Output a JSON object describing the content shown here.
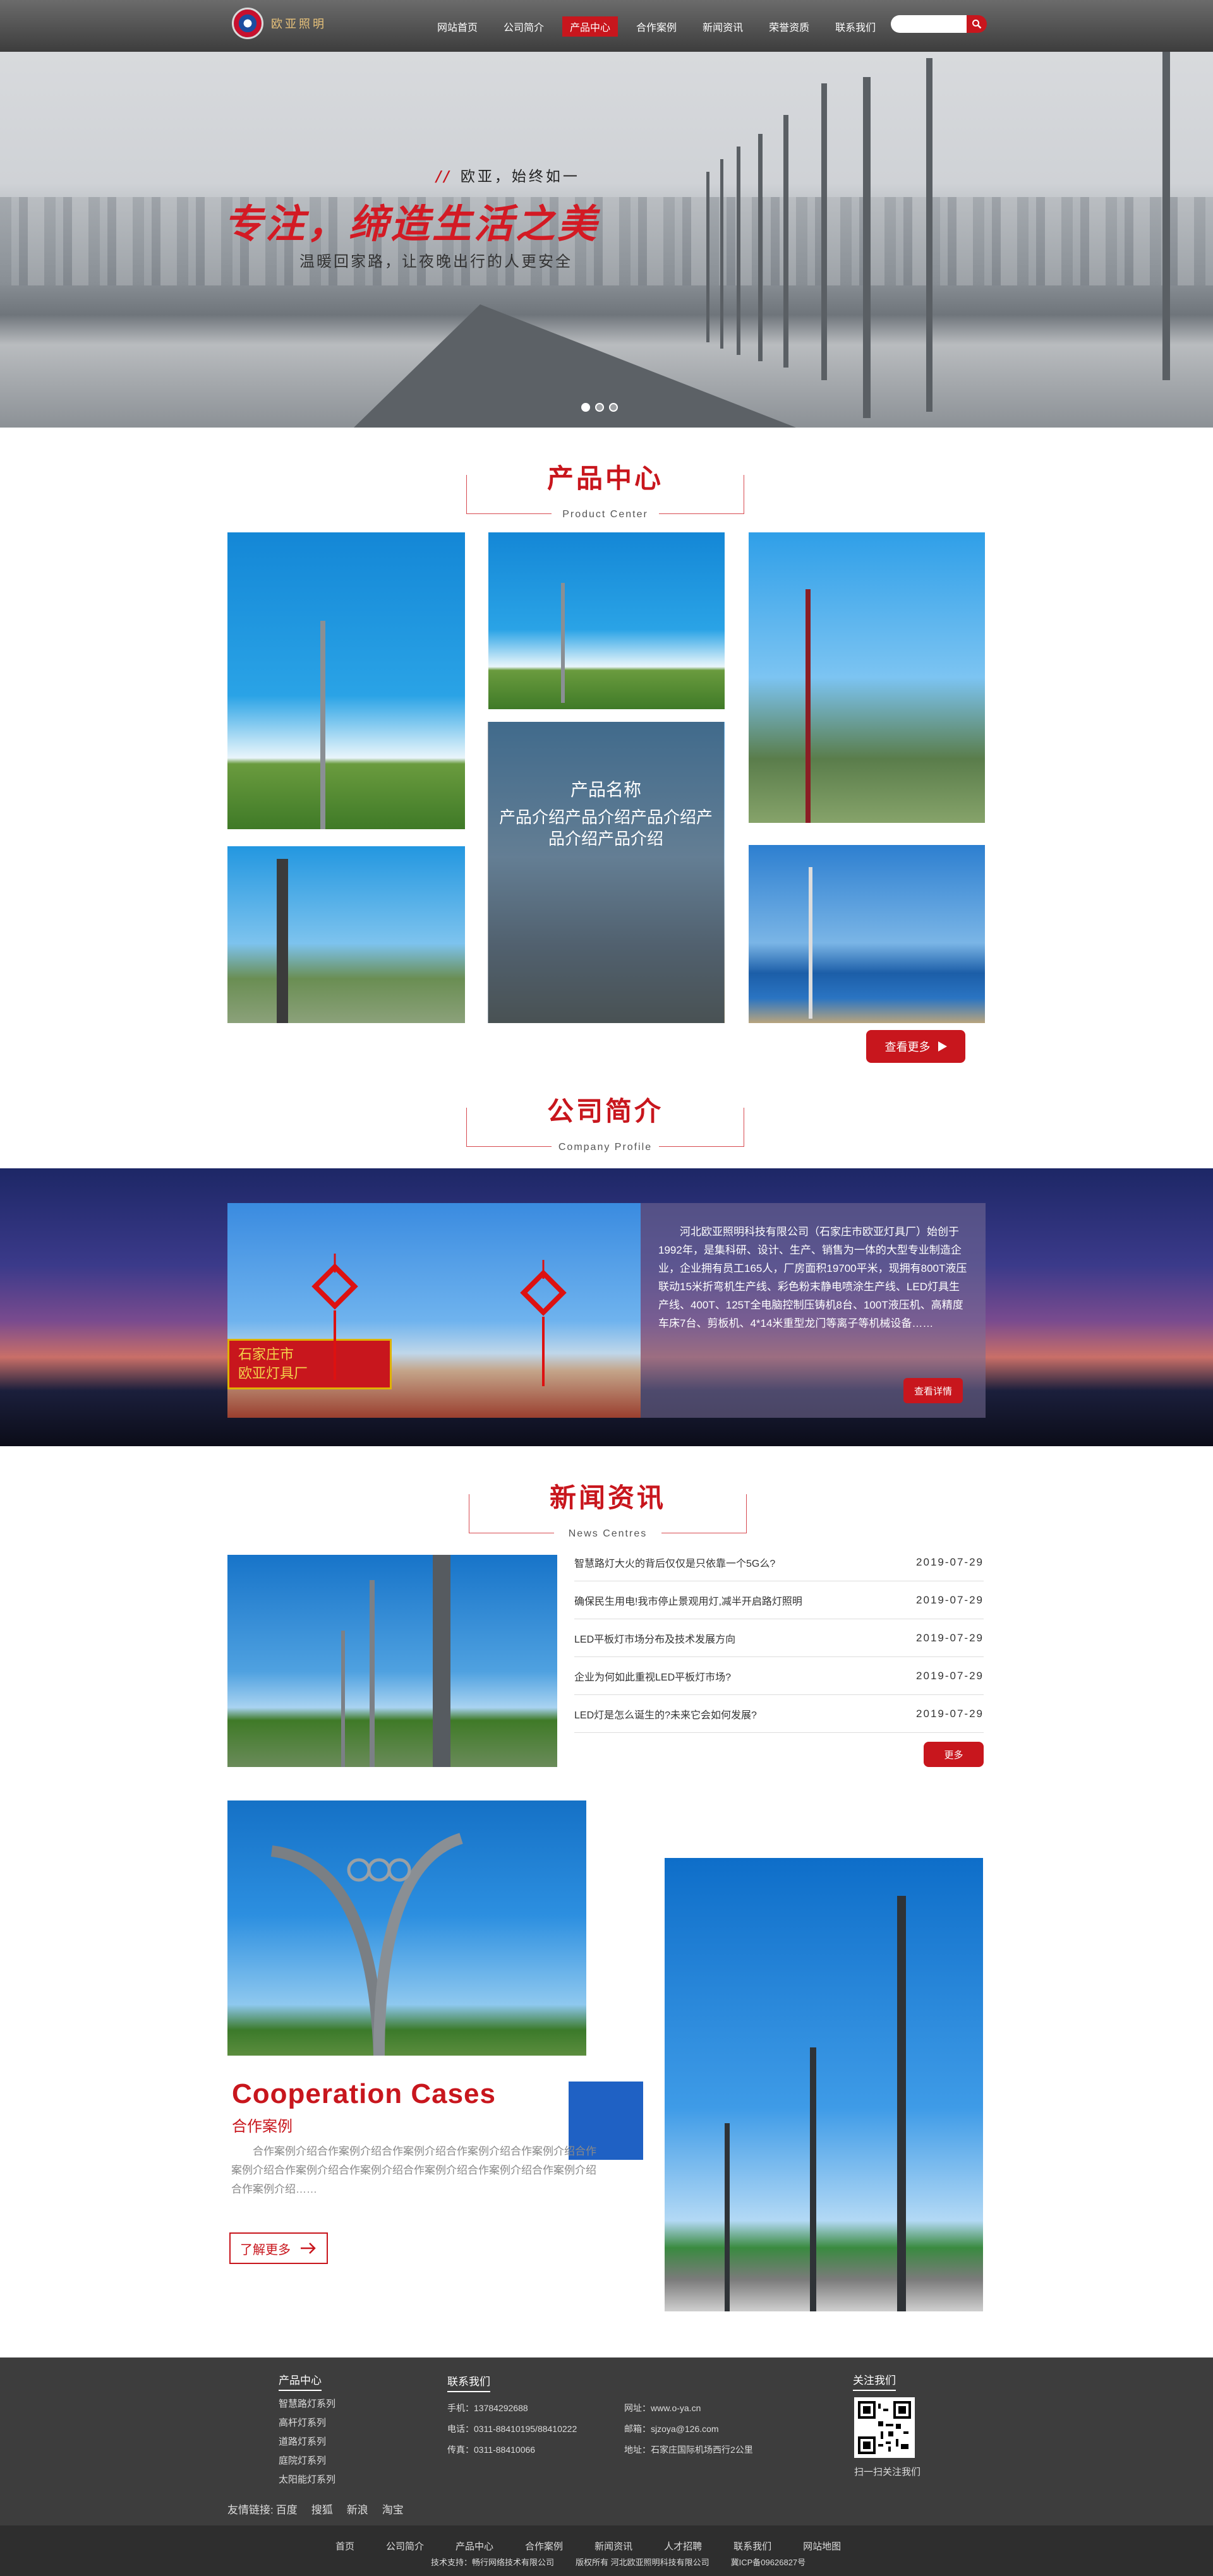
{
  "header": {
    "logo_text": "欧亚照明",
    "nav": [
      {
        "label": "网站首页",
        "active": false
      },
      {
        "label": "公司简介",
        "active": false
      },
      {
        "label": "产品中心",
        "active": true
      },
      {
        "label": "合作案例",
        "active": false
      },
      {
        "label": "新闻资讯",
        "active": false
      },
      {
        "label": "荣誉资质",
        "active": false
      },
      {
        "label": "联系我们",
        "active": false
      }
    ],
    "search_icon": "search-icon"
  },
  "hero": {
    "slogan_small": "欧亚，始终如一",
    "slogan_mark": "//",
    "title": "专注，缔造生活之美",
    "subtitle": "温暖回家路，让夜晚出行的人更安全"
  },
  "products": {
    "title_cn": "产品中心",
    "title_en": "Product Center",
    "overlay_name": "产品名称",
    "overlay_desc": "产品介绍产品介绍产品介绍产品介绍产品介绍",
    "more_label": "查看更多"
  },
  "company": {
    "title_cn": "公司简介",
    "title_en": "Company Profile",
    "text": "河北欧亚照明科技有限公司（石家庄市欧亚灯具厂）始创于1992年，是集科研、设计、生产、销售为一体的大型专业制造企业，企业拥有员工165人，厂房面积19700平米，现拥有800T液压联动15米折弯机生产线、彩色粉末静电喷涂生产线、LED灯具生产线、400T、125T全电脑控制压铸机8台、100T液压机、高精度车床7台、剪板机、4*14米重型龙门等离子等机械设备……",
    "more_label": "查看详情",
    "sign_line1": "石家庄市",
    "sign_line2": "欧亚灯具厂"
  },
  "news": {
    "title_cn": "新闻资讯",
    "title_en": "News Centres",
    "items": [
      {
        "title": "智慧路灯大火的背后仅仅是只依靠一个5G么?",
        "date": "2019-07-29"
      },
      {
        "title": "确保民生用电!我市停止景观用灯,减半开启路灯照明",
        "date": "2019-07-29"
      },
      {
        "title": "LED平板灯市场分布及技术发展方向",
        "date": "2019-07-29"
      },
      {
        "title": "企业为何如此重视LED平板灯市场?",
        "date": "2019-07-29"
      },
      {
        "title": "LED灯是怎么诞生的?未来它会如何发展?",
        "date": "2019-07-29"
      }
    ],
    "more_label": "更多"
  },
  "cases": {
    "title_en": "Cooperation Cases",
    "title_cn": "合作案例",
    "desc": "合作案例介绍合作案例介绍合作案例介绍合作案例介绍合作案例介绍合作案例介绍合作案例介绍合作案例介绍合作案例介绍合作案例介绍合作案例介绍合作案例介绍……",
    "btn_label": "了解更多",
    "btn_icon": "arrow-right-icon"
  },
  "footer": {
    "products_head": "产品中心",
    "products": [
      "智慧路灯系列",
      "高杆灯系列",
      "道路灯系列",
      "庭院灯系列",
      "太阳能灯系列"
    ],
    "contact_head": "联系我们",
    "phone": "手机：13784292688",
    "tel": "电话：0311-88410195/88410222",
    "fax": "传真：0311-88410066",
    "site": "网址：www.o-ya.cn",
    "email": "邮箱：sjzoya@126.com",
    "address": "地址：石家庄国际机场西行2公里",
    "follow_head": "关注我们",
    "qr_caption": "扫一扫关注我们",
    "friend_label": "友情链接:",
    "friend_links": [
      "百度",
      "搜狐",
      "新浪",
      "淘宝"
    ],
    "bottom_nav": [
      "首页",
      "公司简介",
      "产品中心",
      "合作案例",
      "新闻资讯",
      "人才招聘",
      "联系我们",
      "网站地图"
    ],
    "tech": "技术支持：畅行网络技术有限公司",
    "copyright": "版权所有 河北欧亚照明科技有限公司",
    "icp": "冀ICP备09626827号"
  }
}
